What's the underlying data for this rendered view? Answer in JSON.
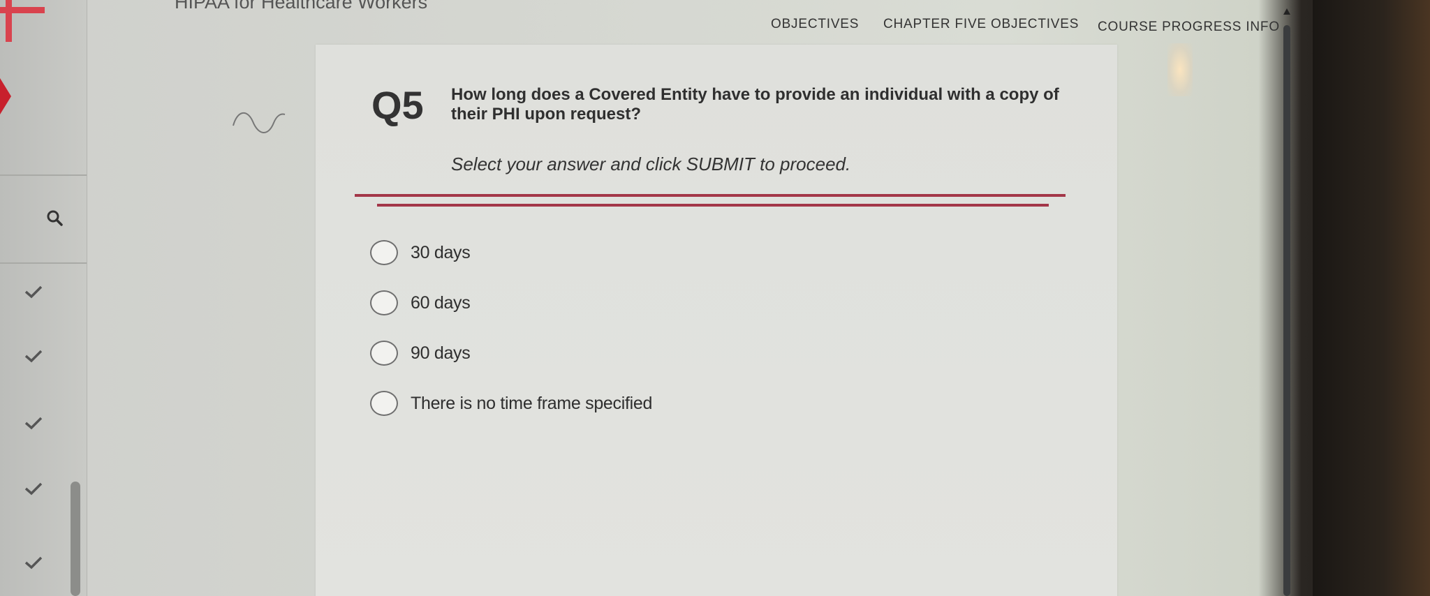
{
  "header": {
    "course_title": "HIPAA for Healthcare Workers",
    "nav": [
      {
        "label": "OBJECTIVES"
      },
      {
        "label": "CHAPTER FIVE OBJECTIVES"
      },
      {
        "label": "COURSE PROGRESS INFO"
      }
    ]
  },
  "question": {
    "number": "Q5",
    "text": "How long does a Covered Entity have to provide an individual with a copy of their PHI upon request?",
    "instruction": "Select your answer and click SUBMIT to proceed.",
    "options": [
      {
        "label": "30 days"
      },
      {
        "label": "60 days"
      },
      {
        "label": "90 days"
      },
      {
        "label": "There is no time frame specified"
      }
    ]
  },
  "colors": {
    "accent_red": "#a33648",
    "brand_red": "#d9434e"
  }
}
